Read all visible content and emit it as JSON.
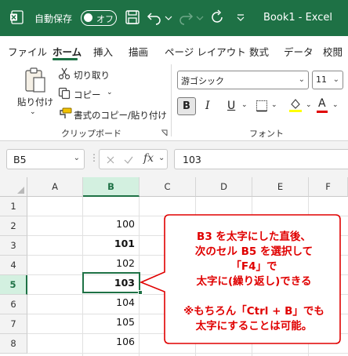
{
  "window": {
    "autosave_label": "自動保存",
    "autosave_state": "オフ",
    "title": "Book1  -  Excel"
  },
  "ribbon_tabs": [
    "ファイル",
    "ホーム",
    "挿入",
    "描画",
    "ページ レイアウト",
    "数式",
    "データ",
    "校閲"
  ],
  "active_tab": "ホーム",
  "clipboard": {
    "paste_label": "貼り付け",
    "cut_label": "切り取り",
    "copy_label": "コピー",
    "format_painter_label": "書式のコピー/貼り付け",
    "group_label": "クリップボード"
  },
  "font": {
    "font_name": "游ゴシック",
    "font_size": "11",
    "bold_label": "B",
    "italic_label": "I",
    "underline_label": "U",
    "font_color_label": "A",
    "group_label": "フォント"
  },
  "formula_bar": {
    "name_box": "B5",
    "fx_label": "fx",
    "value": "103"
  },
  "grid": {
    "columns": [
      "A",
      "B",
      "C",
      "D",
      "E",
      "F"
    ],
    "selected_column": "B",
    "rows": [
      "1",
      "2",
      "3",
      "4",
      "5",
      "6",
      "7",
      "8"
    ],
    "selected_row": "5",
    "column_b_values": [
      "",
      "100",
      "101",
      "102",
      "103",
      "104",
      "105",
      "106"
    ],
    "bold_rows": [
      "3",
      "5"
    ]
  },
  "callout": {
    "lines": [
      "B3 を太字にした直後、",
      "次のセル B5 を選択して",
      "「F4」で",
      "太字に(繰り返し)できる",
      "",
      "※もちろん「Ctrl + B」でも",
      "太字にすることは可能。"
    ],
    "color": "#e00000"
  },
  "colors": {
    "excel_green": "#1e7145",
    "selection_header": "#d3f0e0"
  }
}
